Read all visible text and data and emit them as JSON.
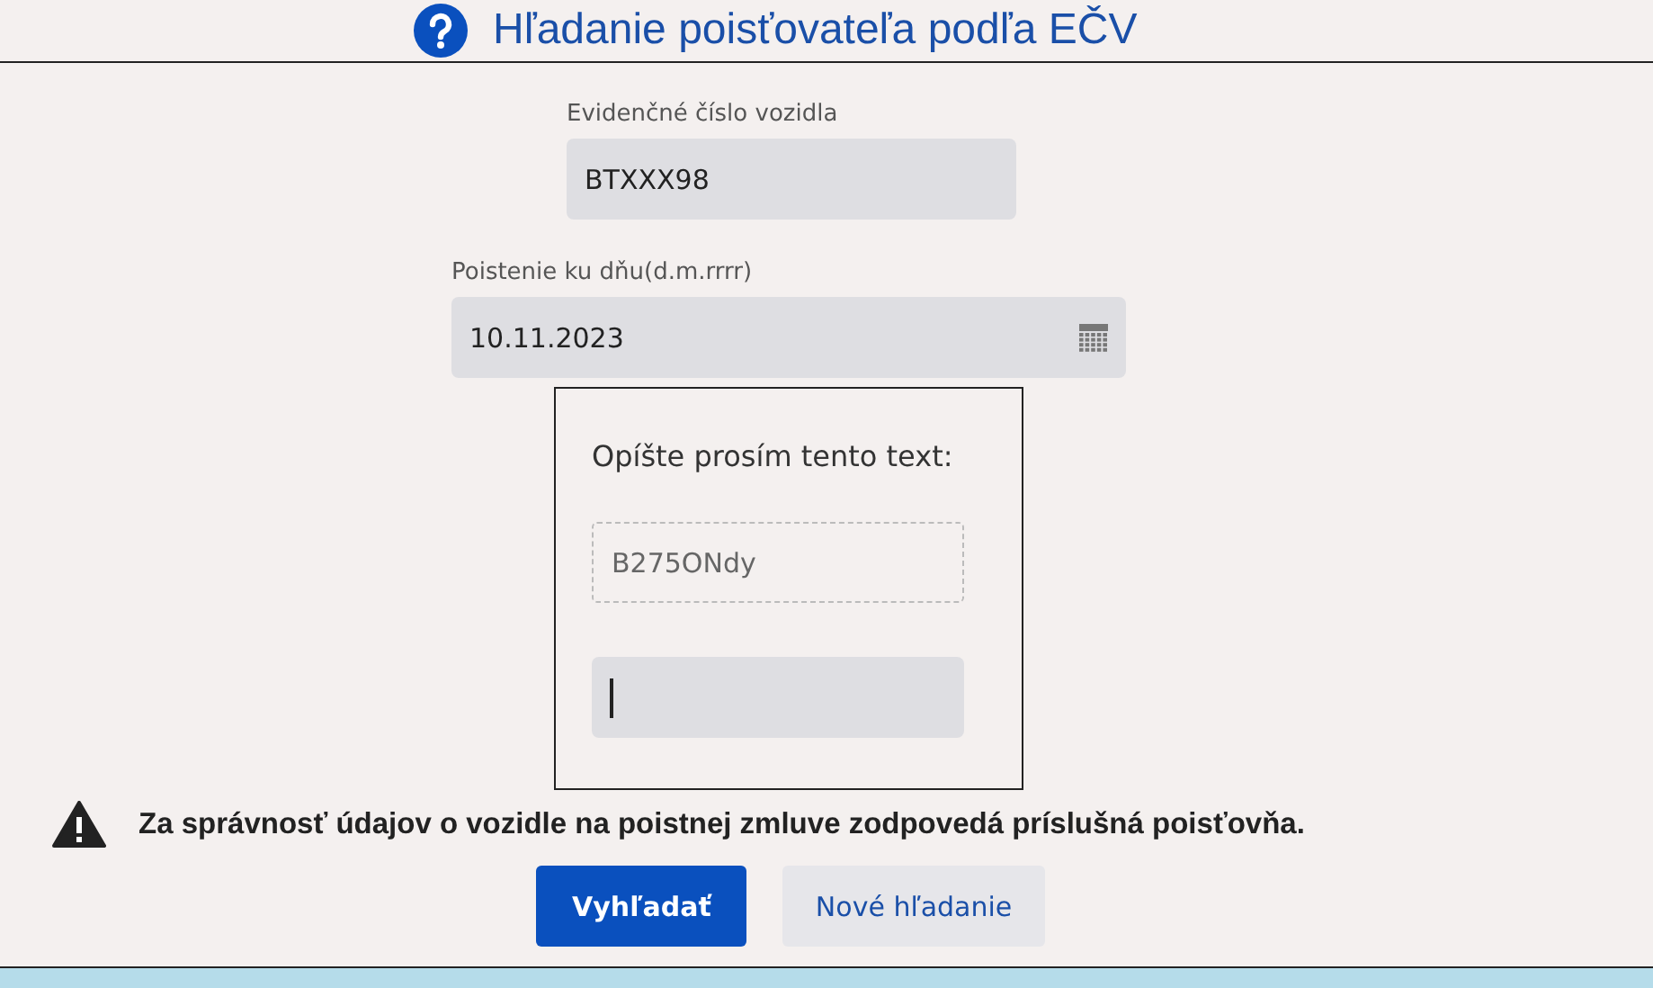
{
  "header": {
    "title": "Hľadanie poisťovateľa podľa EČV"
  },
  "form": {
    "plate": {
      "label": "Evidenčné číslo vozidla",
      "value": "BTXXX98"
    },
    "date": {
      "label": "Poistenie ku dňu(d.m.rrrr)",
      "value": "10.11.2023"
    },
    "captcha": {
      "prompt": "Opíšte prosím tento text:",
      "code": "B275ONdy",
      "answer": {
        "focused": true
      }
    }
  },
  "notice": "Za správnosť údajov o vozidle na poistnej zmluve zodpovedá príslušná poisťovňa.",
  "buttons": [
    {
      "label": "Vyhľadať",
      "kind": "primary"
    },
    {
      "label": "Nové hľadanie",
      "kind": "secondary"
    }
  ]
}
